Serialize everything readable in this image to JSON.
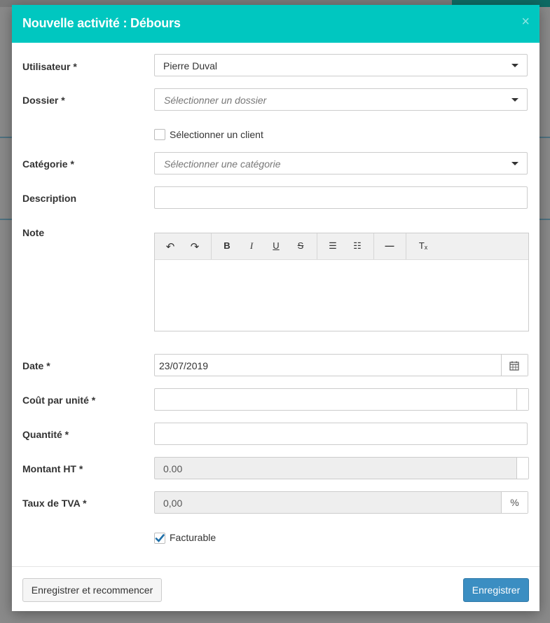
{
  "modal": {
    "title": "Nouvelle activité : Débours",
    "close_glyph": "×"
  },
  "form": {
    "utilisateur": {
      "label": "Utilisateur *",
      "value": "Pierre Duval"
    },
    "dossier": {
      "label": "Dossier *",
      "placeholder": "Sélectionner un dossier"
    },
    "select_client": {
      "label": "Sélectionner un client",
      "checked": false
    },
    "categorie": {
      "label": "Catégorie *",
      "placeholder": "Sélectionner une catégorie"
    },
    "description": {
      "label": "Description",
      "value": ""
    },
    "note": {
      "label": "Note",
      "toolbar": {
        "undo": "↶",
        "redo": "↷",
        "bold": "B",
        "italic": "I",
        "underline": "U",
        "strike": "S",
        "bullet_list": "☰",
        "numbered_list": "☷",
        "hr": "—",
        "clear_format": "Tₓ"
      }
    },
    "date": {
      "label": "Date *",
      "value": "23/07/2019",
      "icon": "calendar-icon"
    },
    "cout_unite": {
      "label": "Coût par unité *",
      "value": ""
    },
    "quantite": {
      "label": "Quantité *",
      "value": ""
    },
    "montant_ht": {
      "label": "Montant HT *",
      "value": "0.00"
    },
    "taux_tva": {
      "label": "Taux de TVA *",
      "value": "0,00",
      "addon": "%"
    },
    "facturable": {
      "label": "Facturable",
      "checked": true
    }
  },
  "footer": {
    "save_and_restart": "Enregistrer et recommencer",
    "save": "Enregistrer"
  },
  "colors": {
    "header": "#00c7c0",
    "primary": "#3b8ec2"
  }
}
